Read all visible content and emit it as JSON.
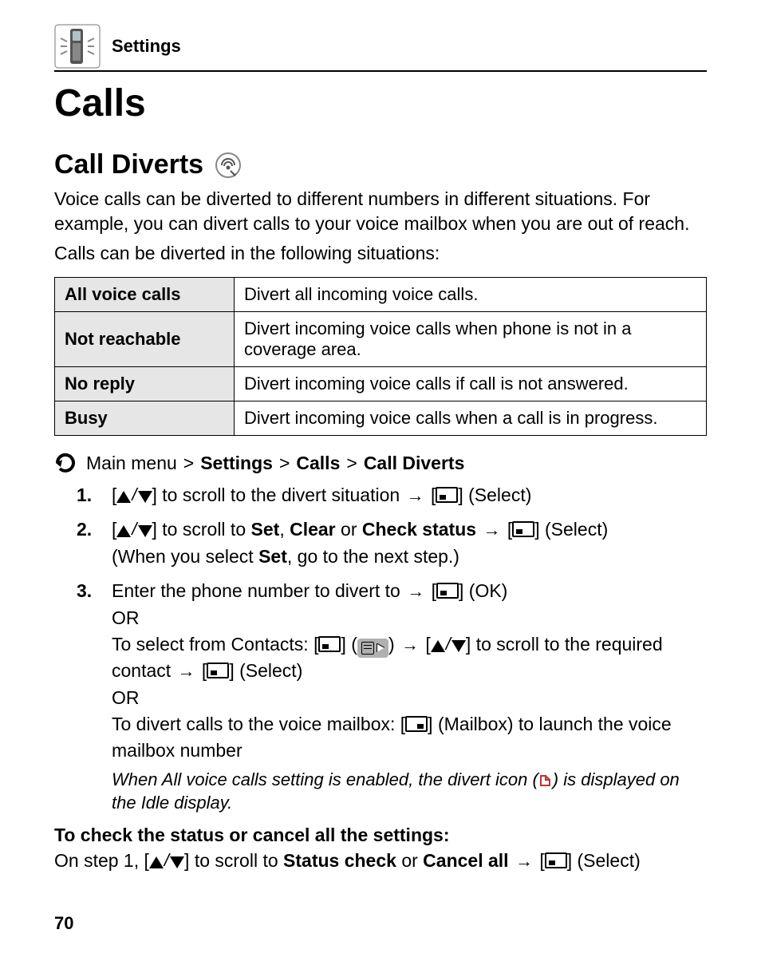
{
  "header": {
    "section": "Settings"
  },
  "title": "Calls",
  "subtitle": "Call Diverts",
  "intro1": "Voice calls can be diverted to different numbers in different situations. For example, you can divert calls to your voice mailbox when you are out of reach.",
  "intro2": "Calls can be diverted in the following situations:",
  "table": {
    "rows": [
      {
        "label": "All voice calls",
        "desc": "Divert all incoming voice calls."
      },
      {
        "label": "Not reachable",
        "desc": "Divert incoming voice calls when phone is not in a coverage area."
      },
      {
        "label": "No reply",
        "desc": "Divert incoming voice calls if call is not answered."
      },
      {
        "label": "Busy",
        "desc": "Divert incoming voice calls when a call is in progress."
      }
    ]
  },
  "nav": {
    "prefix": "Main menu",
    "sep": ">",
    "crumbs": [
      "Settings",
      "Calls",
      "Call Diverts"
    ]
  },
  "steps": {
    "s1": {
      "t1": "to scroll to the divert situation",
      "t2": "(Select)"
    },
    "s2": {
      "t1": "to scroll to",
      "set": "Set",
      "comma": ",",
      "clear": "Clear",
      "or": "or",
      "check": "Check status",
      "t2": "(Select)",
      "line2a": "(When you select",
      "line2b": ", go to the next step.)"
    },
    "s3": {
      "t1": "Enter the phone number to divert to",
      "ok": "(OK)",
      "or": "OR",
      "c1": "To select from Contacts:",
      "c2": "to scroll to the required contact",
      "c3": "(Select)",
      "m1": "To divert calls to the voice mailbox:",
      "m2": "(Mailbox) to launch the voice mailbox number",
      "note1": "When All voice calls setting is enabled, the divert icon",
      "note2": "is displayed on the Idle display."
    }
  },
  "check": {
    "head": "To check the status or cancel all the settings:",
    "b1": "On step 1,",
    "b2": "to scroll to",
    "status": "Status check",
    "or": "or",
    "cancel": "Cancel all",
    "sel": "(Select)"
  },
  "pageNumber": "70"
}
